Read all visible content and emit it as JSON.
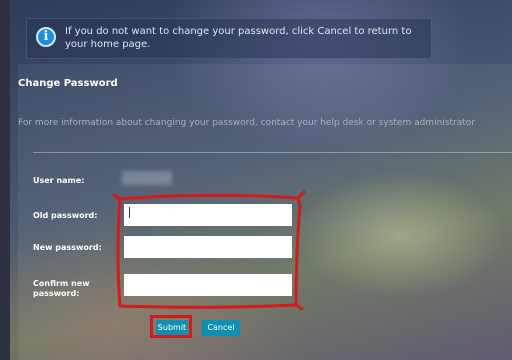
{
  "info_bar": {
    "icon": "info-icon",
    "message": "If you do not want to change your password, click Cancel to return to your home page."
  },
  "form": {
    "title": "Change Password",
    "description": "For more information about changing your password, contact your help desk or system administrator",
    "fields": {
      "user_name_label": "User name:",
      "old_password_label": "Old password:",
      "new_password_label": "New password:",
      "confirm_password_label": "Confirm new password:"
    },
    "buttons": {
      "submit": "Submit",
      "cancel": "Cancel"
    }
  },
  "annotations": {
    "color": "#d61a1a"
  }
}
